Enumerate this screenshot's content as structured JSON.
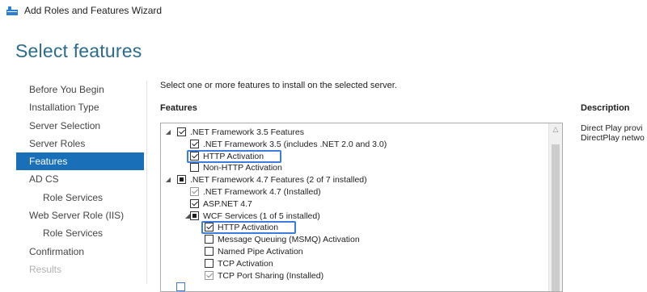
{
  "window": {
    "title": "Add Roles and Features Wizard",
    "icon": "server-manager-icon"
  },
  "page_title": "Select features",
  "nav": [
    {
      "label": "Before You Begin",
      "state": "normal",
      "level": 0
    },
    {
      "label": "Installation Type",
      "state": "normal",
      "level": 0
    },
    {
      "label": "Server Selection",
      "state": "normal",
      "level": 0
    },
    {
      "label": "Server Roles",
      "state": "normal",
      "level": 0
    },
    {
      "label": "Features",
      "state": "active",
      "level": 0
    },
    {
      "label": "AD CS",
      "state": "normal",
      "level": 0
    },
    {
      "label": "Role Services",
      "state": "normal",
      "level": 1
    },
    {
      "label": "Web Server Role (IIS)",
      "state": "normal",
      "level": 0
    },
    {
      "label": "Role Services",
      "state": "normal",
      "level": 1
    },
    {
      "label": "Confirmation",
      "state": "normal",
      "level": 0
    },
    {
      "label": "Results",
      "state": "disabled",
      "level": 0
    }
  ],
  "instruction": "Select one or more features to install on the selected server.",
  "features_heading": "Features",
  "description_heading": "Description",
  "description_lines": [
    "Direct Play provi",
    "DirectPlay netwo"
  ],
  "tree": [
    {
      "label": ".NET Framework 3.5 Features",
      "level": 0,
      "expander": "expanded",
      "state": "checked",
      "highlight": false
    },
    {
      "label": ".NET Framework 3.5 (includes .NET 2.0 and 3.0)",
      "level": 1,
      "expander": "none",
      "state": "checked",
      "highlight": false
    },
    {
      "label": "HTTP Activation",
      "level": 1,
      "expander": "none",
      "state": "checked",
      "highlight": true
    },
    {
      "label": "Non-HTTP Activation",
      "level": 1,
      "expander": "none",
      "state": "unchecked",
      "highlight": false
    },
    {
      "label": ".NET Framework 4.7 Features (2 of 7 installed)",
      "level": 0,
      "expander": "expanded",
      "state": "partial",
      "highlight": false
    },
    {
      "label": ".NET Framework 4.7 (Installed)",
      "level": 1,
      "expander": "none",
      "state": "checked-grayed",
      "highlight": false
    },
    {
      "label": "ASP.NET 4.7",
      "level": 1,
      "expander": "none",
      "state": "checked",
      "highlight": false
    },
    {
      "label": "WCF Services (1 of 5 installed)",
      "level": 1,
      "expander": "expanded",
      "state": "partial",
      "highlight": false
    },
    {
      "label": "HTTP Activation",
      "level": 2,
      "expander": "none",
      "state": "checked",
      "highlight": true
    },
    {
      "label": "Message Queuing (MSMQ) Activation",
      "level": 2,
      "expander": "none",
      "state": "unchecked",
      "highlight": false
    },
    {
      "label": "Named Pipe Activation",
      "level": 2,
      "expander": "none",
      "state": "unchecked",
      "highlight": false
    },
    {
      "label": "TCP Activation",
      "level": 2,
      "expander": "none",
      "state": "unchecked",
      "highlight": false
    },
    {
      "label": "TCP Port Sharing (Installed)",
      "level": 2,
      "expander": "none",
      "state": "checked-grayed",
      "highlight": false
    }
  ],
  "colors": {
    "accent": "#1a6fb9",
    "title": "#2a6c8f",
    "highlight": "#3c7ddb"
  }
}
